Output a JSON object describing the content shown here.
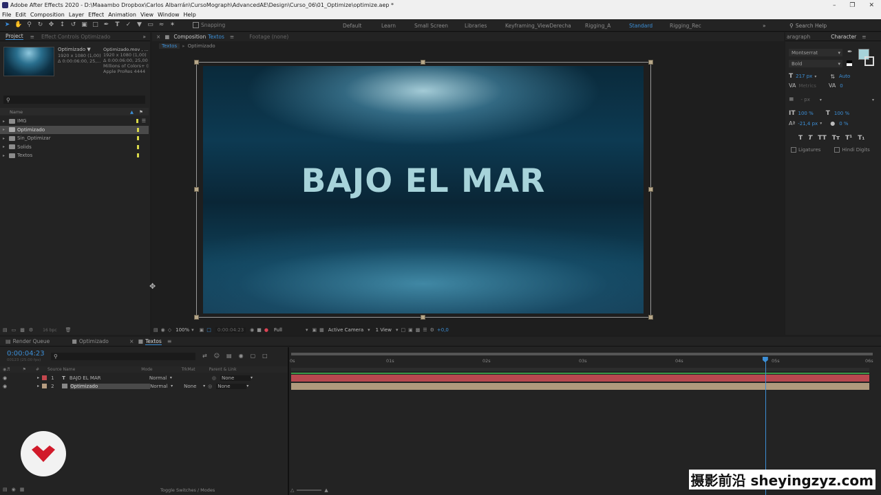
{
  "window": {
    "title": "Adobe After Effects 2020 - D:\\Maaambo Dropbox\\Carlos Albarrán\\CursoMograph\\AdvancedAE\\Design\\Curso_06\\01_Optimize\\optimize.aep *"
  },
  "menu": [
    "File",
    "Edit",
    "Composition",
    "Layer",
    "Effect",
    "Animation",
    "View",
    "Window",
    "Help"
  ],
  "toolbar": {
    "snapping_label": "Snapping",
    "workspaces": [
      "Default",
      "Learn",
      "Small Screen",
      "Libraries",
      "Keyframing_ViewDerecha",
      "Rigging_A",
      "Standard",
      "Rigging_Rec"
    ],
    "active_workspace": "Standard",
    "search_help": "Search Help"
  },
  "project": {
    "tab_label": "Project",
    "effect_controls_label": "Effect Controls Optimizado",
    "thumb_name": "Optimizado ▼",
    "thumb_info1": "1920 x 1080 (1,00)",
    "thumb_info2": "Δ 0:00:06:00, 25,...",
    "file_name": "Optimizado.mov , ...",
    "file_info1": "1920 x 1080 (1,00)",
    "file_info2": "Δ 0:00:06:00, 25,00 fps",
    "file_info3": "Millions of Colors+ (P...",
    "file_info4": "Apple ProRes 4444",
    "search_placeholder": "",
    "col_name": "Name",
    "items": [
      {
        "name": "IMG",
        "tag": "#d9d94a"
      },
      {
        "name": "Optimizado",
        "tag": "#d9d94a",
        "selected": true
      },
      {
        "name": "Sin_Optimizar",
        "tag": "#d9d94a"
      },
      {
        "name": "Solids",
        "tag": "#d9d94a"
      },
      {
        "name": "Textos",
        "tag": "#d9d94a"
      }
    ],
    "bpc": "16 bpc"
  },
  "composition": {
    "tab_prefix": "Composition",
    "tab_name": "Textos",
    "footage_label": "Footage (none)",
    "breadcrumbs": [
      "Textos",
      "Optimizado"
    ],
    "comp_text": "BAJO EL MAR",
    "zoom": "100%",
    "timecode": "0:00:04:23",
    "resolution": "Full",
    "camera": "Active Camera",
    "view": "1 View",
    "exposure": "+0,0"
  },
  "character": {
    "panel_left_label": "aragraph",
    "panel_label": "Character",
    "font": "Montserrat",
    "style": "Bold",
    "size": "217 px",
    "leading": "Auto",
    "kerning": "Metrics",
    "tracking": "0",
    "stroke": "- px",
    "v_scale": "100 %",
    "h_scale": "100 %",
    "baseline": "-21,4 px",
    "tsume": "0 %",
    "ligatures": "Ligatures",
    "hindi": "Hindi Digits",
    "fill_color": "#a7d3da"
  },
  "timeline": {
    "tabs": [
      "Render Queue",
      "Optimizado",
      "Textos"
    ],
    "current_time": "0:00:04:23",
    "frames": "00123 (25.00 fps)",
    "columns": {
      "source": "Source Name",
      "mode": "Mode",
      "trkmat": "TrkMat",
      "parent": "Parent & Link"
    },
    "layers": [
      {
        "num": "1",
        "name": "BAJO EL MAR",
        "type": "T",
        "mode": "Normal",
        "trkmat": "",
        "parent": "None",
        "color": "#c4474e"
      },
      {
        "num": "2",
        "name": "Optimizado",
        "type": "footage",
        "mode": "Normal",
        "trkmat": "None",
        "parent": "None",
        "color": "#b69c80"
      }
    ],
    "ruler": [
      "0s",
      "01s",
      "02s",
      "03s",
      "04s",
      "05s",
      "06s"
    ],
    "playhead_seconds": 4.92,
    "duration_seconds": 6,
    "toggle_label": "Toggle Switches / Modes"
  },
  "watermark": "摄影前沿 sheyingzyz.com"
}
